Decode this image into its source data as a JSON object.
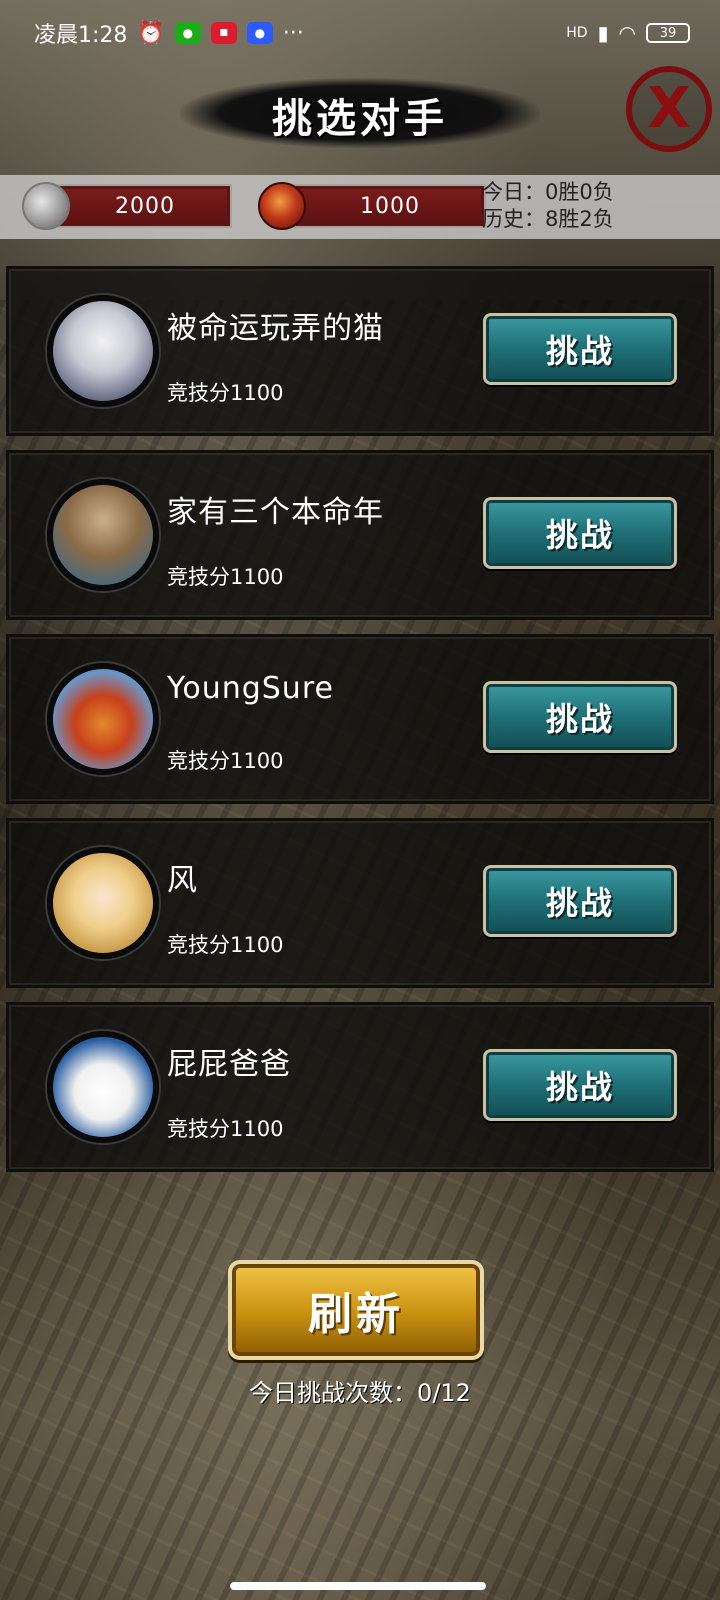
{
  "status_bar": {
    "time": "凌晨1:28",
    "more": "···",
    "network": "HD",
    "battery": "39",
    "icons": [
      "alarm-icon",
      "wechat-icon",
      "app-icon",
      "baidu-icon",
      "signal-icon",
      "wifi-icon",
      "battery-icon"
    ]
  },
  "header": {
    "title": "挑选对手",
    "close_glyph": "X"
  },
  "resources": {
    "coins": "2000",
    "honor": "1000"
  },
  "record": {
    "today": "今日：0胜0负",
    "history": "历史：8胜2负"
  },
  "opponents": [
    {
      "name": "被命运玩弄的猫",
      "score": "竞技分1100",
      "button": "挑战"
    },
    {
      "name": "家有三个本命年",
      "score": "竞技分1100",
      "button": "挑战"
    },
    {
      "name": "YoungSure",
      "score": "竞技分1100",
      "button": "挑战"
    },
    {
      "name": "风",
      "score": "竞技分1100",
      "button": "挑战"
    },
    {
      "name": "屁屁爸爸",
      "score": "竞技分1100",
      "button": "挑战"
    }
  ],
  "footer": {
    "refresh_label": "刷新",
    "challenge_count": "今日挑战次数：0/12"
  },
  "colors": {
    "challenge_button": "#1f6f76",
    "refresh_button": "#c8900f",
    "resource_plate": "#6a1515",
    "close_icon": "#8c0f0f"
  }
}
